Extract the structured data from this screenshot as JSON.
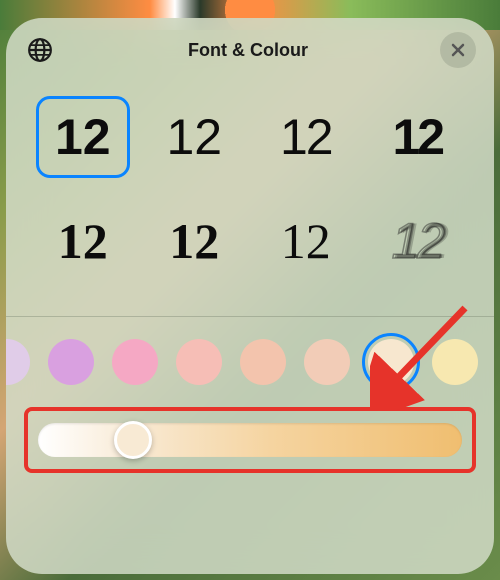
{
  "header": {
    "title": "Font & Colour"
  },
  "fonts": {
    "sample": "12",
    "selected_index": 0,
    "options": [
      "rounded-semibold",
      "sf-light",
      "condensed",
      "impact-bold",
      "serif-bold",
      "serif-black",
      "optima",
      "outline-italic"
    ]
  },
  "colors": {
    "selected_index": 6,
    "palette": [
      "#e0cce8",
      "#d9a0e0",
      "#f5a8c4",
      "#f6beb6",
      "#f3c4ad",
      "#f2ccb7",
      "#f7e7cf",
      "#f7e8b0"
    ]
  },
  "slider": {
    "position_percent": 18
  },
  "annotations": {
    "arrow_target": "selected-color-swatch",
    "highlight_target": "hue-slider"
  }
}
